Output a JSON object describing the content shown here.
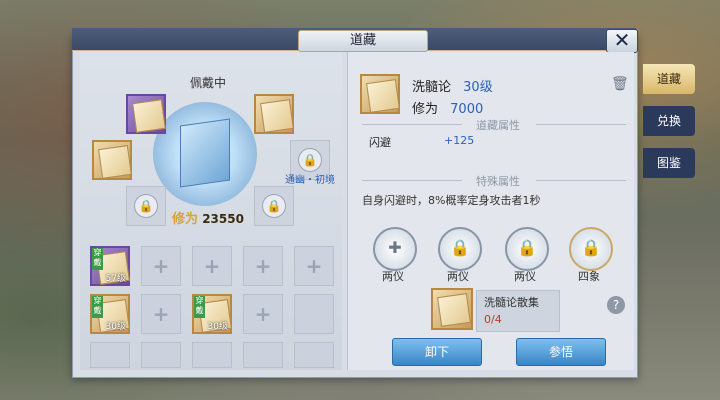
{
  "window": {
    "title": "道藏",
    "close_label": "✕"
  },
  "side_tabs": [
    {
      "label": "道藏",
      "active": true
    },
    {
      "label": "兑换",
      "active": false
    },
    {
      "label": "图鉴",
      "active": false
    }
  ],
  "left": {
    "equipped_title": "佩戴中",
    "power_label": "修为",
    "power_value": "23550",
    "special_tag": "通幽・初境",
    "inventory": [
      {
        "tag": "穿戴",
        "level": "57级"
      },
      {
        "tag": "穿戴",
        "level": "30级"
      },
      {
        "tag": "穿戴",
        "level": "30级"
      }
    ]
  },
  "right": {
    "item_name": "洗髓论",
    "item_level": "30级",
    "cultivation_label": "修为",
    "cultivation_value": "7000",
    "attr_title": "道藏属性",
    "attr_name": "闪避",
    "attr_value": "+125",
    "special_title": "特殊属性",
    "special_desc": "自身闪避时，8%概率定身攻击者1秒",
    "slots": [
      "两仪",
      "两仪",
      "两仪",
      "四象"
    ],
    "collect_title": "洗髓论散集",
    "collect_progress": "0/4",
    "help": "?",
    "unequip_label": "卸下",
    "comprehend_label": "参悟"
  }
}
